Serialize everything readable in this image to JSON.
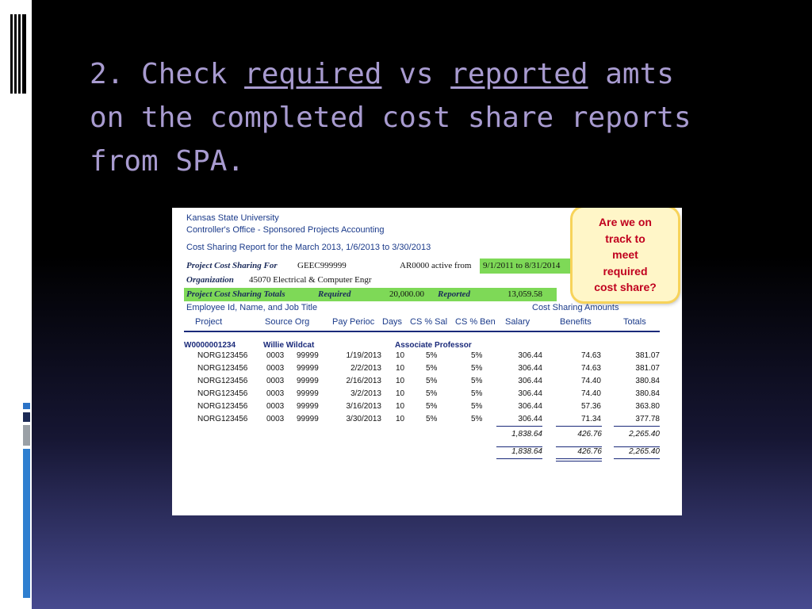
{
  "slide": {
    "title_prefix": "2. Check ",
    "title_word1": "required",
    "title_mid": " vs ",
    "title_word2": "reported",
    "title_suffix": " amts",
    "title_line2": "on the completed cost share reports",
    "title_line3": "from SPA."
  },
  "report": {
    "university": "Kansas State University",
    "office": "Controller's Office - Sponsored Projects Accounting",
    "report_title": "Cost Sharing Report for the March 2013, 1/6/2013 to 3/30/2013",
    "project_label": "Project Cost Sharing For",
    "project_code": "GEEC999999",
    "account_status": "AR0000 active from",
    "active_period": "9/1/2011 to 8/31/2014",
    "org_label": "Organization",
    "org_value": "45070 Electrical  & Computer Engr",
    "totals_label": "Project Cost Sharing Totals",
    "required_label": "Required",
    "required_value": "20,000.00",
    "reported_label": "Reported",
    "reported_value": "13,059.58",
    "employee_header": "Employee Id, Name, and Job Title",
    "cost_sharing_amounts": "Cost Sharing Amounts",
    "columns": [
      "Project",
      "Source Org",
      "Pay Perioc",
      "Days",
      "CS % Sal",
      "CS % Ben",
      "Salary",
      "Benefits",
      "Totals"
    ],
    "employee_id": "W0000001234",
    "employee_name": "Willie Wildcat",
    "job_title": "Associate Professor",
    "rows": [
      {
        "project": "NORG123456",
        "source": "0003",
        "org": "99999",
        "period": "1/19/2013",
        "days": "10",
        "sal_pct": "5%",
        "ben_pct": "5%",
        "salary": "306.44",
        "benefits": "74.63",
        "total": "381.07"
      },
      {
        "project": "NORG123456",
        "source": "0003",
        "org": "99999",
        "period": "2/2/2013",
        "days": "10",
        "sal_pct": "5%",
        "ben_pct": "5%",
        "salary": "306.44",
        "benefits": "74.63",
        "total": "381.07"
      },
      {
        "project": "NORG123456",
        "source": "0003",
        "org": "99999",
        "period": "2/16/2013",
        "days": "10",
        "sal_pct": "5%",
        "ben_pct": "5%",
        "salary": "306.44",
        "benefits": "74.40",
        "total": "380.84"
      },
      {
        "project": "NORG123456",
        "source": "0003",
        "org": "99999",
        "period": "3/2/2013",
        "days": "10",
        "sal_pct": "5%",
        "ben_pct": "5%",
        "salary": "306.44",
        "benefits": "74.40",
        "total": "380.84"
      },
      {
        "project": "NORG123456",
        "source": "0003",
        "org": "99999",
        "period": "3/16/2013",
        "days": "10",
        "sal_pct": "5%",
        "ben_pct": "5%",
        "salary": "306.44",
        "benefits": "57.36",
        "total": "363.80"
      },
      {
        "project": "NORG123456",
        "source": "0003",
        "org": "99999",
        "period": "3/30/2013",
        "days": "10",
        "sal_pct": "5%",
        "ben_pct": "5%",
        "salary": "306.44",
        "benefits": "71.34",
        "total": "377.78"
      }
    ],
    "subtotal": {
      "salary": "1,838.64",
      "benefits": "426.76",
      "total": "2,265.40"
    },
    "grand_total": {
      "salary": "1,838.64",
      "benefits": "426.76",
      "total": "2,265.40"
    }
  },
  "callout": {
    "line1": "Are we on",
    "line2": "track to",
    "line3": "meet",
    "line4": "required",
    "line5": "cost share?"
  },
  "colors": {
    "title": "#a89bd0",
    "callout_text": "#c0001e",
    "highlight_green": "#7ed957",
    "report_blue": "#1a3a8a"
  }
}
